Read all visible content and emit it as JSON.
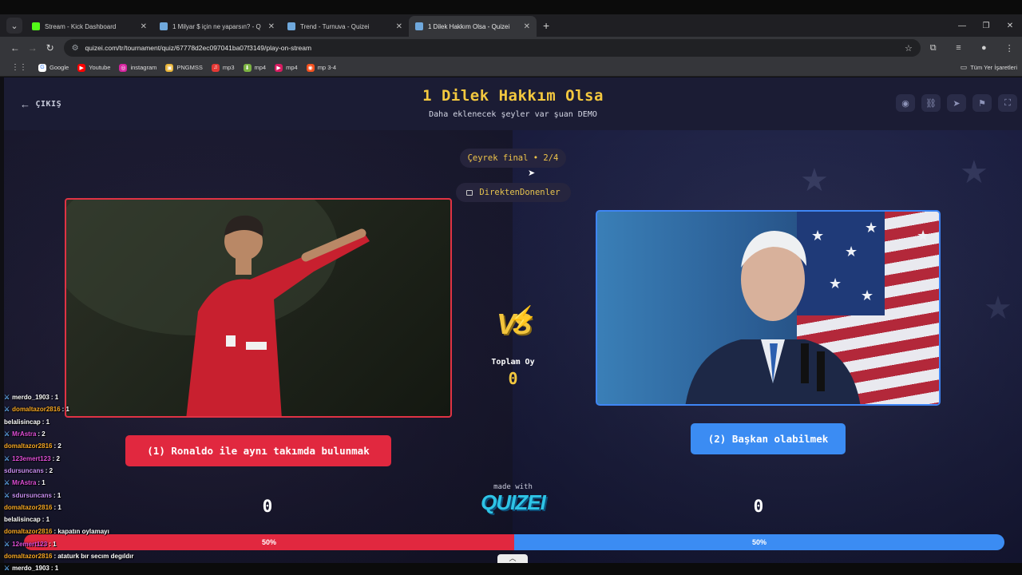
{
  "browser": {
    "tabs": [
      {
        "title": "Stream - Kick Dashboard",
        "favicon_color": "#53fc18",
        "favicon_char": "K",
        "active": false
      },
      {
        "title": "1 Milyar $ için ne yaparsın? - Q",
        "favicon_color": "#6fa8dc",
        "favicon_char": "",
        "active": false
      },
      {
        "title": "Trend - Turnuva - Quizei",
        "favicon_color": "#6fa8dc",
        "favicon_char": "",
        "active": false
      },
      {
        "title": "1 Dilek Hakkım Olsa - Quizei",
        "favicon_color": "#6fa8dc",
        "favicon_char": "",
        "active": true
      }
    ],
    "url": "quizei.com/tr/tournament/quiz/67778d2ec097041ba07f3149/play-on-stream",
    "bookmarks": [
      {
        "label": "Google",
        "color": "#ffffff",
        "char": "G"
      },
      {
        "label": "Youtube",
        "color": "#ff0000",
        "char": "▶"
      },
      {
        "label": "instagram",
        "color": "#d6249f",
        "char": "◎"
      },
      {
        "label": "PNGMSS",
        "color": "#e8b437",
        "char": "▣"
      },
      {
        "label": "mp3",
        "color": "#e53935",
        "char": "♫"
      },
      {
        "label": "mp4",
        "color": "#7cb342",
        "char": "⬇"
      },
      {
        "label": "mp4",
        "color": "#d81b60",
        "char": "▶"
      },
      {
        "label": "mp 3-4",
        "color": "#f4511e",
        "char": "◉"
      }
    ],
    "all_bookmarks": "Tüm Yer İşaretleri"
  },
  "header": {
    "exit_label": "ÇIKIŞ",
    "title": "1 Dilek Hakkım Olsa",
    "subtitle": "Daha eklenecek şeyler var şuan DEMO"
  },
  "round_label": "Çeyrek final • 2/4",
  "streamer": "DirektenDonenler",
  "vs_label": "VS",
  "total": {
    "label": "Toplam Oy",
    "value": "0"
  },
  "left": {
    "option": "(1) Ronaldo ile aynı takımda bulunmak",
    "score": "0",
    "percent_label": "50%",
    "percent": 50
  },
  "right": {
    "option": "(2) Başkan olabilmek",
    "score": "0",
    "percent_label": "50%",
    "percent": 50
  },
  "footer": {
    "made_with": "made with",
    "logo": "QUIZEI"
  },
  "chat": [
    {
      "user": "merdo_1903",
      "msg": ": 1",
      "color": "#ffffff",
      "sword": true
    },
    {
      "user": "domaltazor2816",
      "msg": ": 1",
      "color": "#f5a623",
      "sword": true
    },
    {
      "user": "belalisincap",
      "msg": ": 1",
      "color": "#ffffff",
      "sword": false
    },
    {
      "user": "MrAstra",
      "msg": ": 2",
      "color": "#e04fd8",
      "sword": true
    },
    {
      "user": "domaltazor2816",
      "msg": ": 2",
      "color": "#f5a623",
      "sword": false
    },
    {
      "user": "123emert123",
      "msg": ": 2",
      "color": "#e04fd8",
      "sword": true
    },
    {
      "user": "sdursuncans",
      "msg": ": 2",
      "color": "#c78ef0",
      "sword": false
    },
    {
      "user": "MrAstra",
      "msg": ": 1",
      "color": "#e04fd8",
      "sword": true
    },
    {
      "user": "sdursuncans",
      "msg": ": 1",
      "color": "#c78ef0",
      "sword": true
    },
    {
      "user": "domaltazor2816",
      "msg": ": 1",
      "color": "#f5a623",
      "sword": false
    },
    {
      "user": "belalisincap",
      "msg": ": 1",
      "color": "#ffffff",
      "sword": false
    },
    {
      "user": "domaltazor2816",
      "msg": ": kapatın oylamayı",
      "color": "#f5a623",
      "sword": false
    },
    {
      "user": "12emert123",
      "msg": ": 1",
      "color": "#e04fd8",
      "sword": true
    },
    {
      "user": "domaltazor2816",
      "msg": ": ataturk bır secım degıldır",
      "color": "#f5a623",
      "sword": false
    },
    {
      "user": "merdo_1903",
      "msg": ": 1",
      "color": "#ffffff",
      "sword": true
    }
  ],
  "colors": {
    "accent": "#f3c83f",
    "left": "#e1283f",
    "right": "#3b8cf3"
  }
}
